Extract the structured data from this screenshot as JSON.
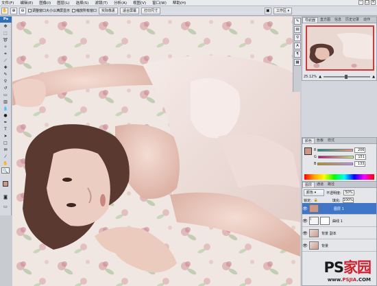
{
  "menu": [
    "文件(F)",
    "编辑(E)",
    "图像(I)",
    "图层(L)",
    "选择(S)",
    "滤镜(T)",
    "分析(A)",
    "视图(V)",
    "窗口(W)",
    "帮助(H)"
  ],
  "options": {
    "resize_windows": "调整窗口大小以满屏显示",
    "zoom_all": "缩放所有窗口",
    "actual_pixels": "实际像素",
    "fit_screen": "适合屏幕",
    "print_size": "打印尺寸",
    "workspace": "工作区"
  },
  "toolbox": {
    "logo": "Ps"
  },
  "navigator": {
    "tabs": [
      "导航器",
      "直方图",
      "信息",
      "历史记录",
      "动作"
    ],
    "zoom": "25.12%"
  },
  "color": {
    "tabs": [
      "颜色",
      "色板",
      "样式"
    ],
    "channels": [
      {
        "label": "R",
        "value": "206"
      },
      {
        "label": "G",
        "value": "151"
      },
      {
        "label": "B",
        "value": "133"
      }
    ],
    "swatch": "#ce9785"
  },
  "layers": {
    "tabs": [
      "图层",
      "通道",
      "路径"
    ],
    "blend_mode": "颜色",
    "opacity_label": "不透明度:",
    "opacity": "50%",
    "lock_label": "锁定:",
    "fill_label": "填充:",
    "fill": "100%",
    "items": [
      {
        "name": "图层 1",
        "selected": true
      },
      {
        "name": "曲线 1",
        "selected": false
      },
      {
        "name": "背景 副本",
        "selected": false
      },
      {
        "name": "背景",
        "selected": false
      }
    ]
  },
  "watermark": {
    "logo_ps": "PS",
    "logo_text": "家园",
    "url_pre": "www.",
    "url_brand": "PSJIA",
    "url_post": ".COM"
  }
}
